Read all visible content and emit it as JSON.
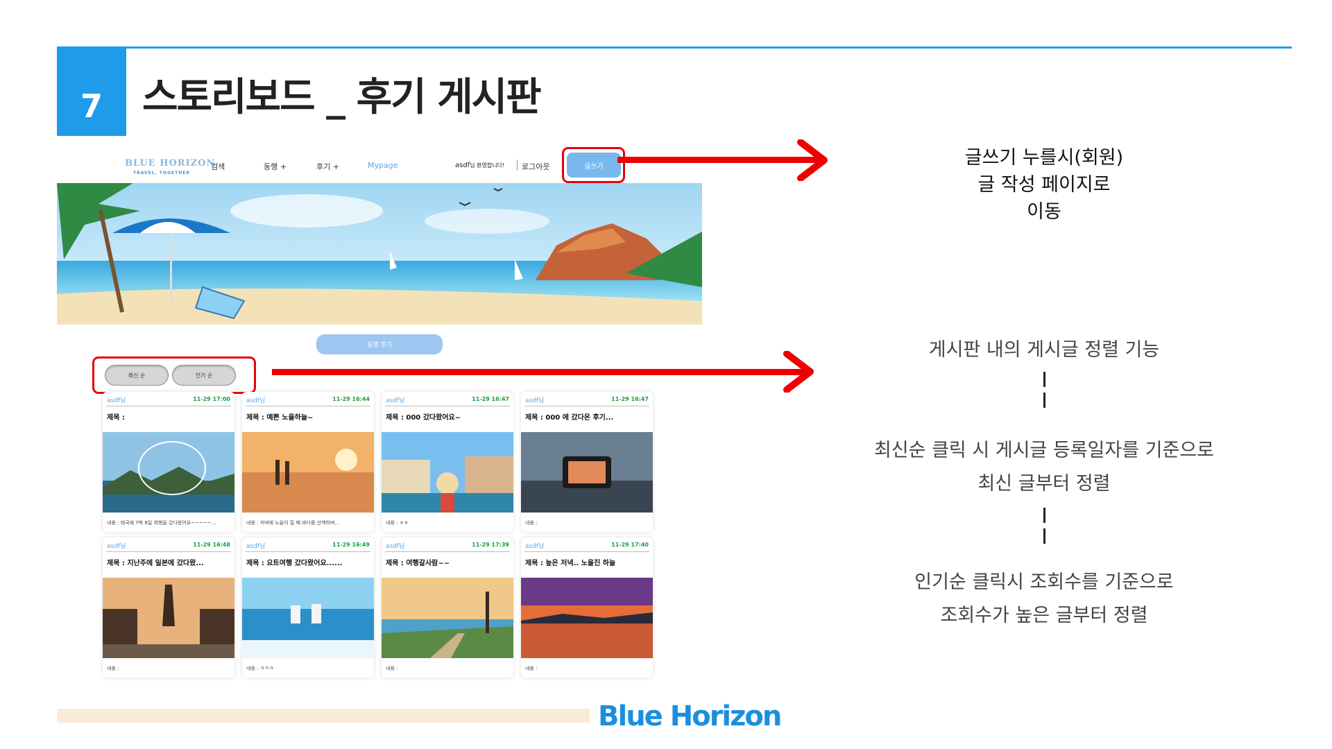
{
  "slide": {
    "number": "7",
    "title": "스토리보드 _  후기 게시판",
    "footer_brand": "Blue Horizon"
  },
  "nav": {
    "logo": "BLUE HORIZON",
    "logo_sub": "TRAVEL, TOGETHER",
    "items": [
      "검색",
      "동행 +",
      "후기 +",
      "Mypage"
    ],
    "greeting_user": "asdf",
    "greeting_suffix": "님 환영합니다!",
    "logout": "로그아웃",
    "write_button": "글쓰기"
  },
  "board": {
    "center_button": "동행 후기",
    "sort_latest": "최신 순",
    "sort_popular": "인기 순",
    "cards": [
      {
        "user": "asdf님",
        "date": "11-29 17:00",
        "title": "제목 :",
        "body": "내용 : 태국에 7박 8일 여행을 갔다왔어요~~~~~...",
        "image": "temple-city-stamp"
      },
      {
        "user": "asdf님",
        "date": "11-29 16:44",
        "title": "제목 : 예쁜 노을하늘~",
        "body": "내용 : 저녁에 노을이 질 때 바다를 산책하며...",
        "image": "sunset-beach-couple"
      },
      {
        "user": "asdf님",
        "date": "11-29 16:47",
        "title": "제목 : 000 갔다왔어요~",
        "body": "내용 : ㅎㅎ",
        "image": "canal-city"
      },
      {
        "user": "asdf님",
        "date": "11-29 16:47",
        "title": "제목 : 000 에 갔다온 후기...",
        "body": "내용 :",
        "image": "phone-photo"
      },
      {
        "user": "asdf님",
        "date": "11-29 16:48",
        "title": "제목 : 지난주에 일본에 갔다왔...",
        "body": "내용 :",
        "image": "kyoto-street"
      },
      {
        "user": "asdf님",
        "date": "11-29 16:49",
        "title": "제목 : 요트여행 갔다왔어요......",
        "body": "내용 : ㅋㅋㅋ",
        "image": "yacht-sea"
      },
      {
        "user": "asdf님",
        "date": "11-29 17:39",
        "title": "제목 : 여행갈사람~~",
        "body": "내용 :",
        "image": "coast-path"
      },
      {
        "user": "asdf님",
        "date": "11-29 17:40",
        "title": "제목 : 높은 저녁.. 노을진 하늘",
        "body": "내용 :",
        "image": "sunset-lake"
      }
    ]
  },
  "notes": {
    "write_note": [
      "글쓰기 누를시(회원)",
      "글 작성 페이지로",
      "이동"
    ],
    "sort_heading": "게시판 내의 게시글 정렬 기능",
    "latest_note": [
      "최신순 클릭 시 게시글 등록일자를 기준으로",
      "최신 글부터 정렬"
    ],
    "popular_note": [
      "인기순 클릭시 조회수를 기준으로",
      "조회수가 높은 글부터 정렬"
    ]
  },
  "colors": {
    "accent": "#1e9be9",
    "highlight_red": "#ee0000",
    "button_blue": "#78b8ee",
    "date_green": "#1b9e3e"
  }
}
